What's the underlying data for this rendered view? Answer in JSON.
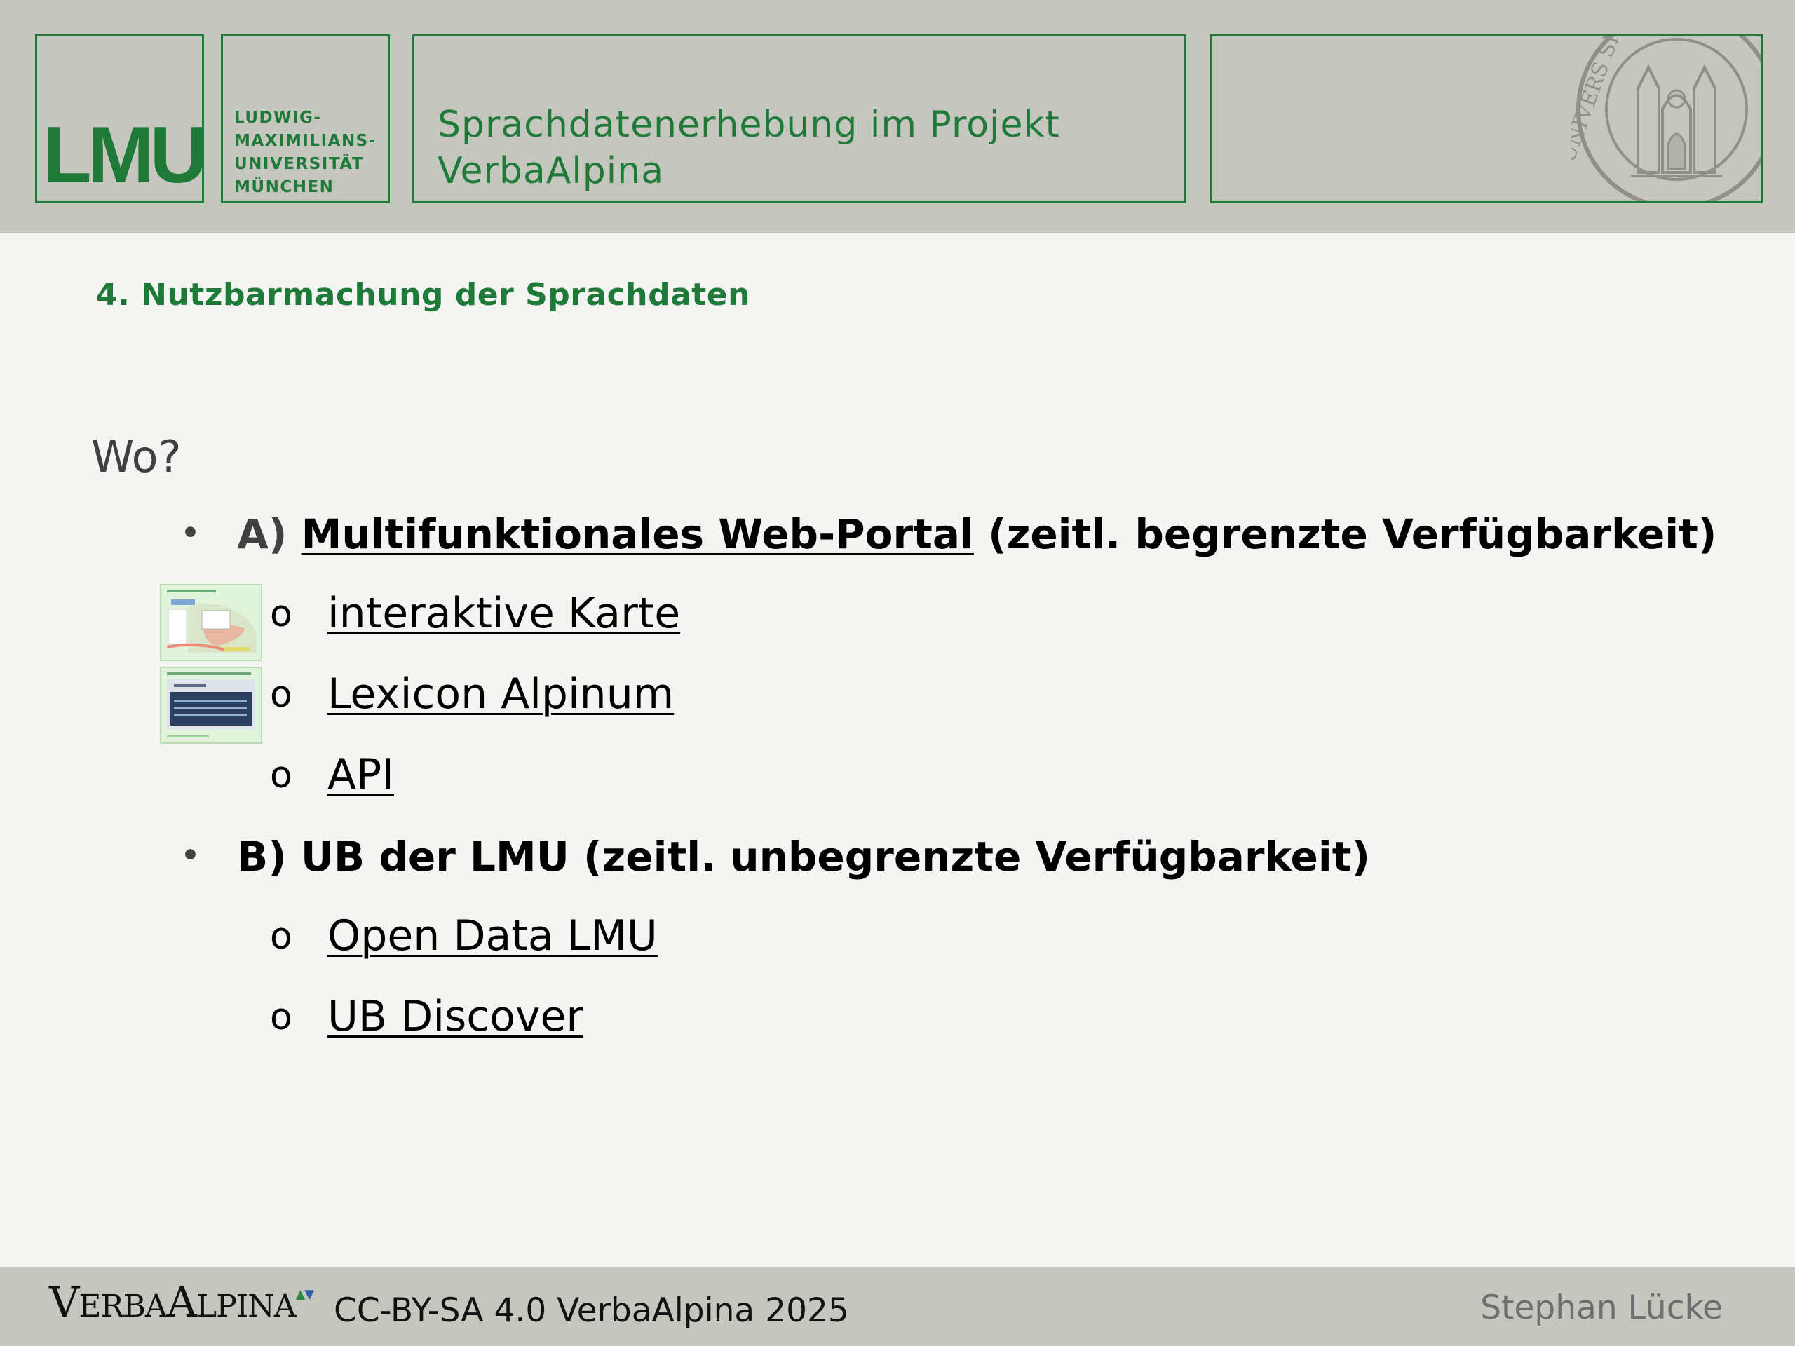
{
  "header": {
    "logo": "LMU",
    "university_lines": [
      "LUDWIG-",
      "MAXIMILIANS-",
      "UNIVERSITÄT",
      "MÜNCHEN"
    ],
    "title_line1": "Sprachdatenerhebung im Projekt",
    "title_line2": "VerbaAlpina",
    "seal_text": "UNIVERS SIGIL",
    "brand_color": "#1f7a3a"
  },
  "slide": {
    "section_title": "4. Nutzbarmachung der Sprachdaten",
    "question": "Wo?",
    "item_a": {
      "lead": "A)",
      "link": "Multifunktionales Web-Portal",
      "rest": "(zeitl. begrenzte Verfügbarkeit)"
    },
    "sub_a": [
      "interaktive Karte",
      "Lexicon Alpinum",
      "API"
    ],
    "item_b": {
      "text": "B) UB der LMU (zeitl. unbegrenzte Verfügbarkeit)"
    },
    "sub_b": [
      "Open Data LMU",
      "UB Discover"
    ],
    "bullet": "•",
    "sub_bullet": "o"
  },
  "footer": {
    "logo_v": "V",
    "logo_erba": "ERBA",
    "logo_a": "A",
    "logo_lpina": "LPINA",
    "license": "CC-BY-SA 4.0 VerbaAlpina 2025",
    "author": "Stephan Lücke"
  }
}
